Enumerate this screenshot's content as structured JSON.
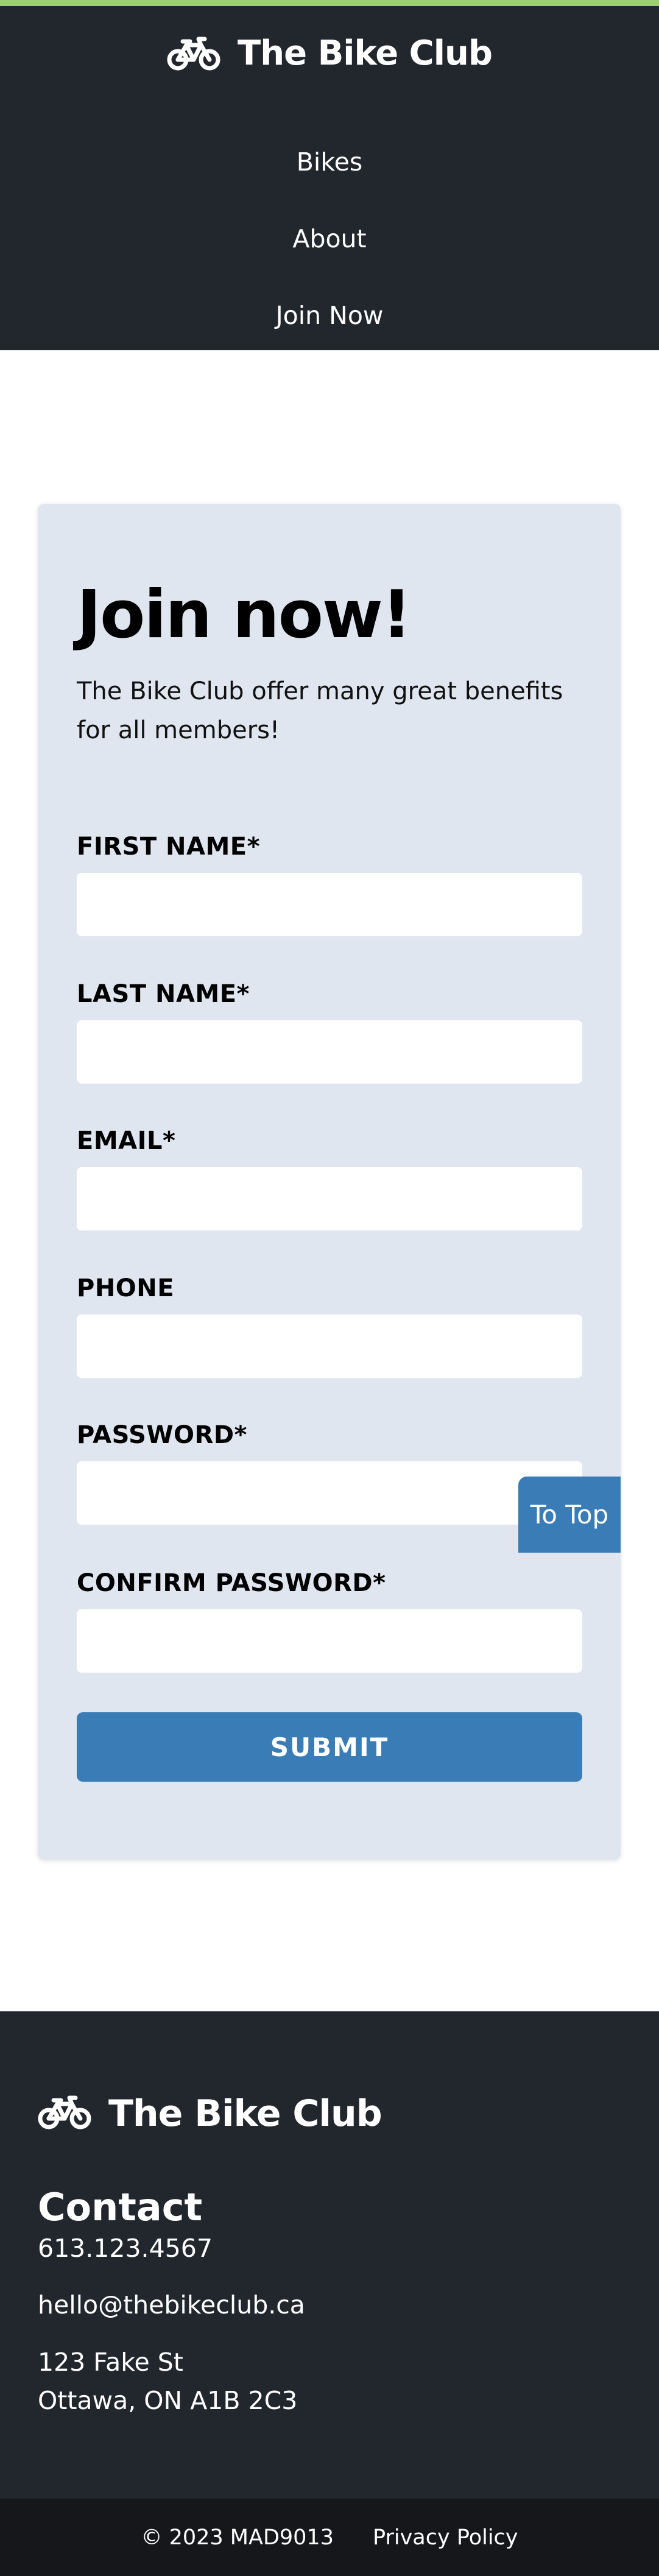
{
  "header": {
    "brand_icon": "bicycle-icon",
    "brand_title": "The Bike Club",
    "nav": [
      {
        "label": "Bikes"
      },
      {
        "label": "About"
      },
      {
        "label": "Join Now"
      }
    ]
  },
  "form": {
    "title": "Join now!",
    "description": "The Bike Club offer many great benefits for all members!",
    "fields": [
      {
        "label": "FIRST NAME*",
        "value": "",
        "placeholder": ""
      },
      {
        "label": "LAST NAME*",
        "value": "",
        "placeholder": ""
      },
      {
        "label": "EMAIL*",
        "value": "",
        "placeholder": ""
      },
      {
        "label": "PHONE",
        "value": "",
        "placeholder": ""
      },
      {
        "label": "PASSWORD*",
        "value": "",
        "placeholder": ""
      },
      {
        "label": "CONFIRM PASSWORD*",
        "value": "",
        "placeholder": ""
      }
    ],
    "submit_label": "SUBMIT"
  },
  "to_top_label": "To Top",
  "footer": {
    "brand_icon": "bicycle-icon",
    "brand_title": "The Bike Club",
    "contact_heading": "Contact",
    "phone": "613.123.4567",
    "email": "hello@thebikeclub.ca",
    "address_line1": "123 Fake St",
    "address_line2": "Ottawa, ON A1B 2C3"
  },
  "bottombar": {
    "copyright": "© 2023 MAD9013",
    "privacy_label": "Privacy Policy"
  },
  "colors": {
    "accent_stripe": "#9ccf76",
    "dark_bg": "#22262d",
    "darker_bg": "#15171b",
    "card_bg": "#e0e6ef",
    "button_blue": "#3a7cb6"
  }
}
